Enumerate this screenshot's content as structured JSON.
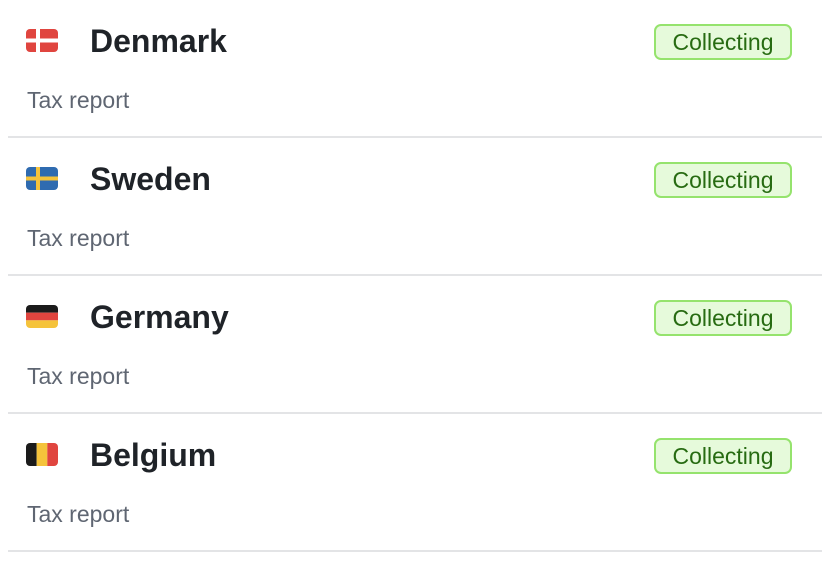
{
  "colors": {
    "badge_text": "#276b12",
    "badge_bg": "#e6fadb",
    "badge_border": "#95e36d",
    "title_text": "#1f2328",
    "subtitle_text": "#5f6672",
    "divider": "#e3e4e6"
  },
  "rows": [
    {
      "country": "Denmark",
      "subtitle": "Tax report",
      "status": "Collecting",
      "flag_icon": "denmark-flag-icon"
    },
    {
      "country": "Sweden",
      "subtitle": "Tax report",
      "status": "Collecting",
      "flag_icon": "sweden-flag-icon"
    },
    {
      "country": "Germany",
      "subtitle": "Tax report",
      "status": "Collecting",
      "flag_icon": "germany-flag-icon"
    },
    {
      "country": "Belgium",
      "subtitle": "Tax report",
      "status": "Collecting",
      "flag_icon": "belgium-flag-icon"
    }
  ]
}
